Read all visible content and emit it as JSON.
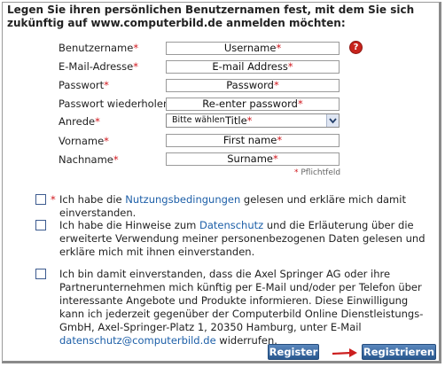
{
  "intro": "Legen Sie ihren persönlichen Benutzernamen fest, mit dem Sie sich zukünftig auf www.computerbild.de anmelden möchten:",
  "form": {
    "username_label": "Benutzername",
    "username_value": "Username",
    "email_label": "E-Mail-Adresse",
    "email_value": "E-mail Address",
    "password_label": "Passwort",
    "password_value": "Password",
    "password_repeat_label": "Passwort wiederholen",
    "password_repeat_value": "Re-enter password",
    "salutation_label": "Anrede",
    "salutation_option": "Bitte wählen",
    "salutation_value": "Title",
    "firstname_label": "Vorname",
    "firstname_value": "First name",
    "lastname_label": "Nachname",
    "lastname_value": "Surname",
    "required_star": "*",
    "required_note": "Pflichtfeld"
  },
  "consents": {
    "terms_before": "Ich habe die ",
    "terms_link": "Nutzungsbedingungen",
    "terms_after": " gelesen und erkläre mich damit einverstanden.",
    "privacy_before": "Ich habe die Hinweise zum ",
    "privacy_link": "Datenschutz",
    "privacy_after": " und die Erläuterung über die erweiterte Verwendung meiner personenbezogenen Daten gelesen und erkläre mich mit ihnen einverstanden.",
    "marketing_text": "Ich bin damit einverstanden, dass die Axel Springer AG oder ihre Partnerunternehmen mich künftig per E-Mail und/oder per Telefon über interessante Angebote und Produkte informieren. Diese Einwilligung kann ich jederzeit gegenüber der Computerbild Online Dienstleistungs-GmbH, Axel-Springer-Platz 1, 20350 Hamburg, unter E-Mail ",
    "marketing_link": "datenschutz@computerbild.de",
    "marketing_after": " widerrufen."
  },
  "buttons": {
    "register": "Register",
    "registrieren": "Registrieren"
  },
  "icons": {
    "help": "help-icon",
    "dropdown": "chevron-down-icon",
    "arrow": "arrow-right-icon"
  },
  "colors": {
    "required": "#d0161c",
    "link": "#1d5fa8",
    "button": "#3a6aa3",
    "arrow": "#cc1f1f"
  }
}
